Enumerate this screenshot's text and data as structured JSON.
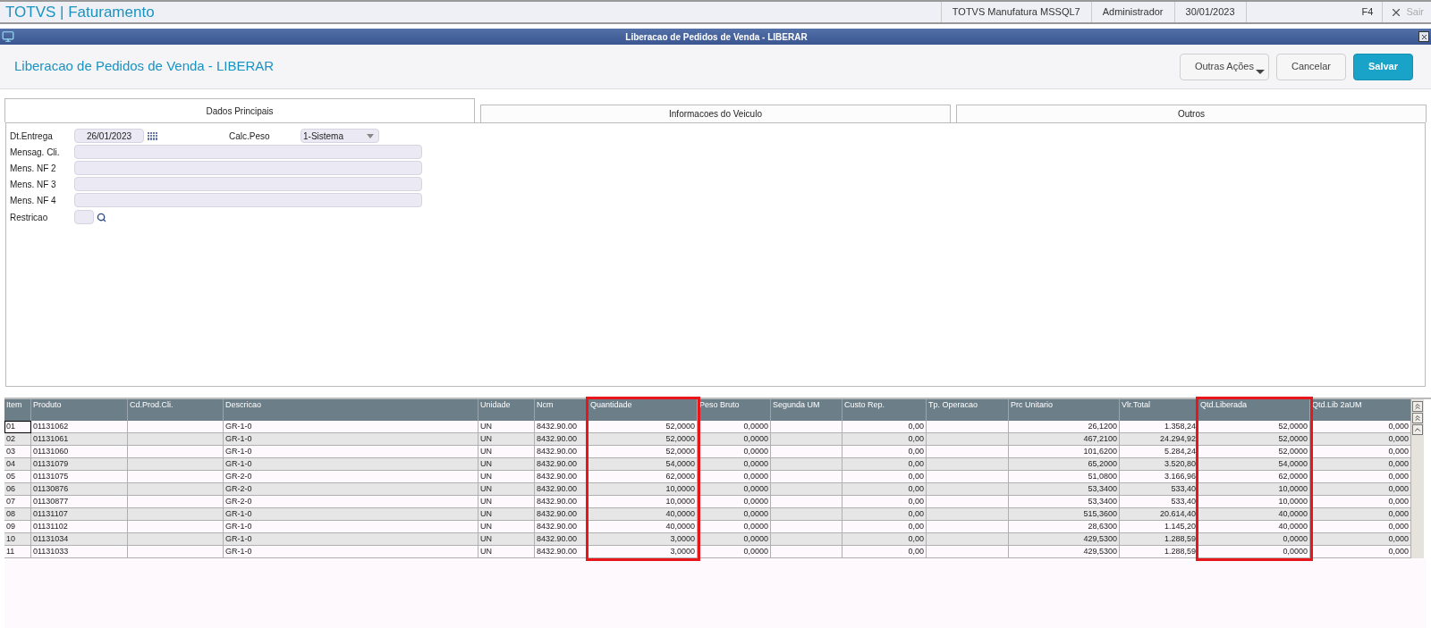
{
  "top_bar": {
    "title": "TOTVS | Faturamento",
    "items": [
      "TOTVS Manufatura MSSQL7",
      "Administrador",
      "30/01/2023"
    ],
    "shortcut": "F4",
    "exit": "Sair"
  },
  "window": {
    "title": "Liberacao de Pedidos de Venda - LIBERAR"
  },
  "header": {
    "title": "Liberacao de Pedidos de Venda - LIBERAR",
    "buttons": [
      {
        "label": "Outras Ações",
        "kind": "menu"
      },
      {
        "label": "Cancelar",
        "kind": "plain"
      },
      {
        "label": "Salvar",
        "kind": "primary"
      }
    ]
  },
  "tabs": [
    {
      "label": "Dados Principais",
      "selected": true
    },
    {
      "label": "Informacoes do Veiculo",
      "selected": false
    },
    {
      "label": "Outros",
      "selected": false
    }
  ],
  "form": {
    "date": {
      "label": "Dt.Entrega",
      "value": "26/01/2023"
    },
    "calc": {
      "label": "Calc.Peso",
      "value": "1-Sistema"
    },
    "fields": [
      {
        "label": "Mensag. Cli."
      },
      {
        "label": "Mens. NF 2"
      },
      {
        "label": "Mens. NF 3"
      },
      {
        "label": "Mens. NF 4"
      }
    ],
    "lookup": {
      "label": "Restricao"
    }
  },
  "table": {
    "columns": [
      {
        "label": "Item",
        "kind": "text",
        "highlighted": false
      },
      {
        "label": "Produto",
        "kind": "text",
        "highlighted": false
      },
      {
        "label": "Cd.Prod.Cli.",
        "kind": "text",
        "highlighted": false
      },
      {
        "label": "Descricao",
        "kind": "text",
        "highlighted": false
      },
      {
        "label": "Unidade",
        "kind": "text",
        "highlighted": false
      },
      {
        "label": "Ncm",
        "kind": "text",
        "highlighted": false
      },
      {
        "label": "Quantidade",
        "kind": "number",
        "highlighted": true
      },
      {
        "label": "Peso Bruto",
        "kind": "number",
        "highlighted": false
      },
      {
        "label": "Segunda UM",
        "kind": "text",
        "highlighted": false
      },
      {
        "label": "Custo Rep.",
        "kind": "number",
        "highlighted": false
      },
      {
        "label": "Tp. Operacao",
        "kind": "text",
        "highlighted": false
      },
      {
        "label": "Prc Unitario",
        "kind": "number",
        "highlighted": false
      },
      {
        "label": "Vlr.Total",
        "kind": "number",
        "highlighted": false
      },
      {
        "label": "Qtd.Liberada",
        "kind": "number",
        "highlighted": true
      },
      {
        "label": "Qtd.Lib 2aUM",
        "kind": "number",
        "highlighted": false
      }
    ],
    "rows": [
      [
        "01",
        "01131062",
        "",
        "GR-1-0",
        "UN",
        "8432.90.00",
        "52,0000",
        "0,0000",
        "",
        "0,00",
        "",
        "26,1200",
        "1.358,24",
        "52,0000",
        "0,000"
      ],
      [
        "02",
        "01131061",
        "",
        "GR-1-0",
        "UN",
        "8432.90.00",
        "52,0000",
        "0,0000",
        "",
        "0,00",
        "",
        "467,2100",
        "24.294,92",
        "52,0000",
        "0,000"
      ],
      [
        "03",
        "01131060",
        "",
        "GR-1-0",
        "UN",
        "8432.90.00",
        "52,0000",
        "0,0000",
        "",
        "0,00",
        "",
        "101,6200",
        "5.284,24",
        "52,0000",
        "0,000"
      ],
      [
        "04",
        "01131079",
        "",
        "GR-1-0",
        "UN",
        "8432.90.00",
        "54,0000",
        "0,0000",
        "",
        "0,00",
        "",
        "65,2000",
        "3.520,80",
        "54,0000",
        "0,000"
      ],
      [
        "05",
        "01131075",
        "",
        "GR-2-0",
        "UN",
        "8432.90.00",
        "62,0000",
        "0,0000",
        "",
        "0,00",
        "",
        "51,0800",
        "3.166,96",
        "62,0000",
        "0,000"
      ],
      [
        "06",
        "01130876",
        "",
        "GR-2-0",
        "UN",
        "8432.90.00",
        "10,0000",
        "0,0000",
        "",
        "0,00",
        "",
        "53,3400",
        "533,40",
        "10,0000",
        "0,000"
      ],
      [
        "07",
        "01130877",
        "",
        "GR-2-0",
        "UN",
        "8432.90.00",
        "10,0000",
        "0,0000",
        "",
        "0,00",
        "",
        "53,3400",
        "533,40",
        "10,0000",
        "0,000"
      ],
      [
        "08",
        "01131107",
        "",
        "GR-1-0",
        "UN",
        "8432.90.00",
        "40,0000",
        "0,0000",
        "",
        "0,00",
        "",
        "515,3600",
        "20.614,40",
        "40,0000",
        "0,000"
      ],
      [
        "09",
        "01131102",
        "",
        "GR-1-0",
        "UN",
        "8432.90.00",
        "40,0000",
        "0,0000",
        "",
        "0,00",
        "",
        "28,6300",
        "1.145,20",
        "40,0000",
        "0,000"
      ],
      [
        "10",
        "01131034",
        "",
        "GR-1-0",
        "UN",
        "8432.90.00",
        "3,0000",
        "0,0000",
        "",
        "0,00",
        "",
        "429,5300",
        "1.288,59",
        "0,0000",
        "0,000"
      ],
      [
        "11",
        "01131033",
        "",
        "GR-1-0",
        "UN",
        "8432.90.00",
        "3,0000",
        "0,0000",
        "",
        "0,00",
        "",
        "429,5300",
        "1.288,59",
        "0,0000",
        "0,000"
      ]
    ]
  }
}
